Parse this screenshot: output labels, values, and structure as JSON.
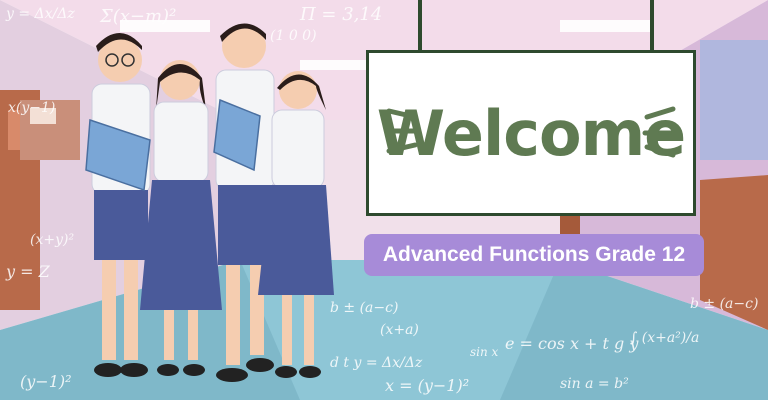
{
  "banner": {
    "welcome_text": "Welcome",
    "subtitle": "Advanced Functions Grade 12"
  },
  "math_doodles": [
    "y = Δx/Δz",
    "Σ(x−m)²",
    "Π = 3,14",
    "(1 0 0)",
    "x(y−1)",
    "(x+y)²",
    "y = Z",
    "b ± (a−c)",
    "(x+a)",
    "d t y = Δx/Δz",
    "x = (y−1)²",
    "e = cos x + t g y",
    "sin x",
    "∫ (x+a²)/a",
    "b ± (a−c)",
    "sin a = b²",
    "(y−1)²"
  ],
  "colors": {
    "sign_text": "#5f7a52",
    "subtitle_bg": "#a78bd8",
    "floor": "#7fb8c9",
    "ceiling": "#f3dcea",
    "wall_left": "#e3cfe0",
    "wall_right": "#d7b9d9",
    "shirt": "#f4f5f7",
    "skirt": "#4a5a9a",
    "book": "#7aa6d6"
  }
}
